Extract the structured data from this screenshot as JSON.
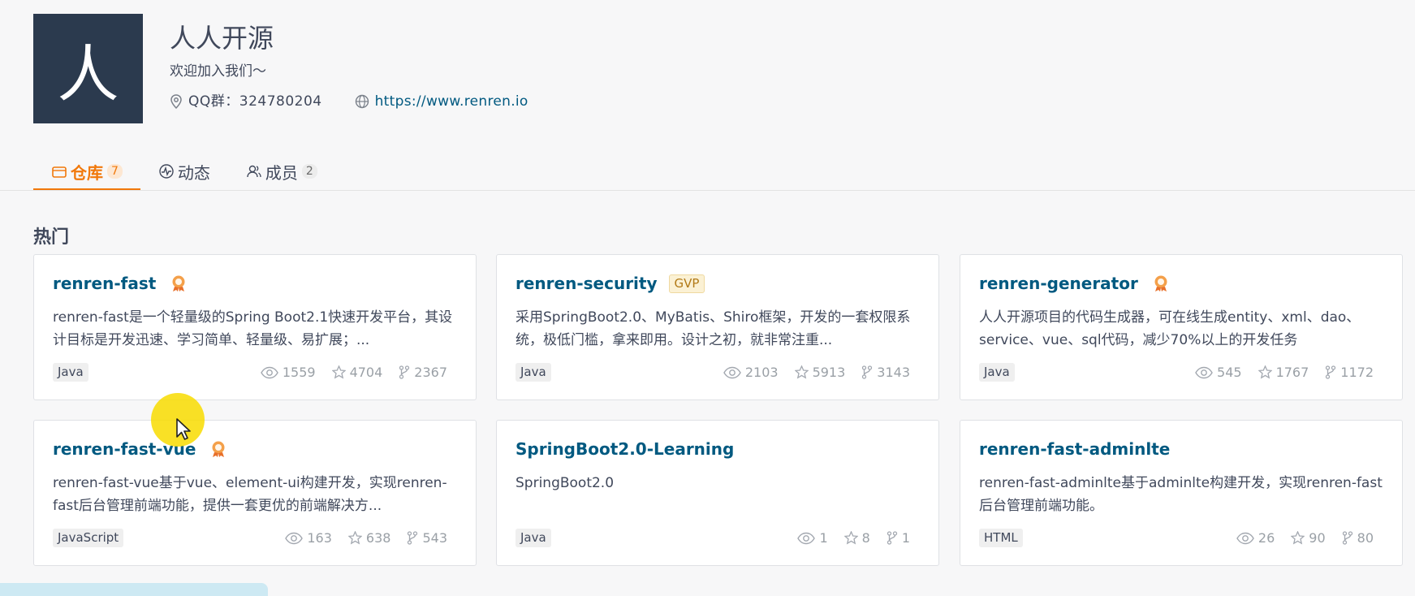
{
  "org": {
    "avatar_char": "人",
    "name": "人人开源",
    "description": "欢迎加入我们～",
    "qq": "QQ群：324780204",
    "website": "https://www.renren.io"
  },
  "tabs": [
    {
      "label": "仓库",
      "count": "7",
      "icon": "repo-icon",
      "active": true
    },
    {
      "label": "动态",
      "count": "",
      "icon": "activity-icon",
      "active": false
    },
    {
      "label": "成员",
      "count": "2",
      "icon": "members-icon",
      "active": false
    }
  ],
  "section_title": "热门",
  "colors": {
    "accent": "#f1780a",
    "link": "#005980",
    "avatar_bg": "#2b3a4e"
  },
  "repos": [
    {
      "name": "renren-fast",
      "badge": "award-icon",
      "description": "renren-fast是一个轻量级的Spring Boot2.1快速开发平台，其设计目标是开发迅速、学习简单、轻量级、易扩展；...",
      "language": "Java",
      "watches": "1559",
      "stars": "4704",
      "forks": "2367"
    },
    {
      "name": "renren-security",
      "badge": "GVP",
      "description": "采用SpringBoot2.0、MyBatis、Shiro框架，开发的一套权限系统，极低门槛，拿来即用。设计之初，就非常注重...",
      "language": "Java",
      "watches": "2103",
      "stars": "5913",
      "forks": "3143"
    },
    {
      "name": "renren-generator",
      "badge": "award-icon",
      "description": "人人开源项目的代码生成器，可在线生成entity、xml、dao、service、vue、sql代码，减少70%以上的开发任务",
      "language": "Java",
      "watches": "545",
      "stars": "1767",
      "forks": "1172"
    },
    {
      "name": "renren-fast-vue",
      "badge": "award-icon",
      "description": "renren-fast-vue基于vue、element-ui构建开发，实现renren-fast后台管理前端功能，提供一套更优的前端解决方...",
      "language": "JavaScript",
      "watches": "163",
      "stars": "638",
      "forks": "543"
    },
    {
      "name": "SpringBoot2.0-Learning",
      "badge": "",
      "description": "SpringBoot2.0",
      "language": "Java",
      "watches": "1",
      "stars": "8",
      "forks": "1"
    },
    {
      "name": "renren-fast-adminlte",
      "badge": "",
      "description": "renren-fast-adminlte基于adminlte构建开发，实现renren-fast后台管理前端功能。",
      "language": "HTML",
      "watches": "26",
      "stars": "90",
      "forks": "80"
    }
  ]
}
